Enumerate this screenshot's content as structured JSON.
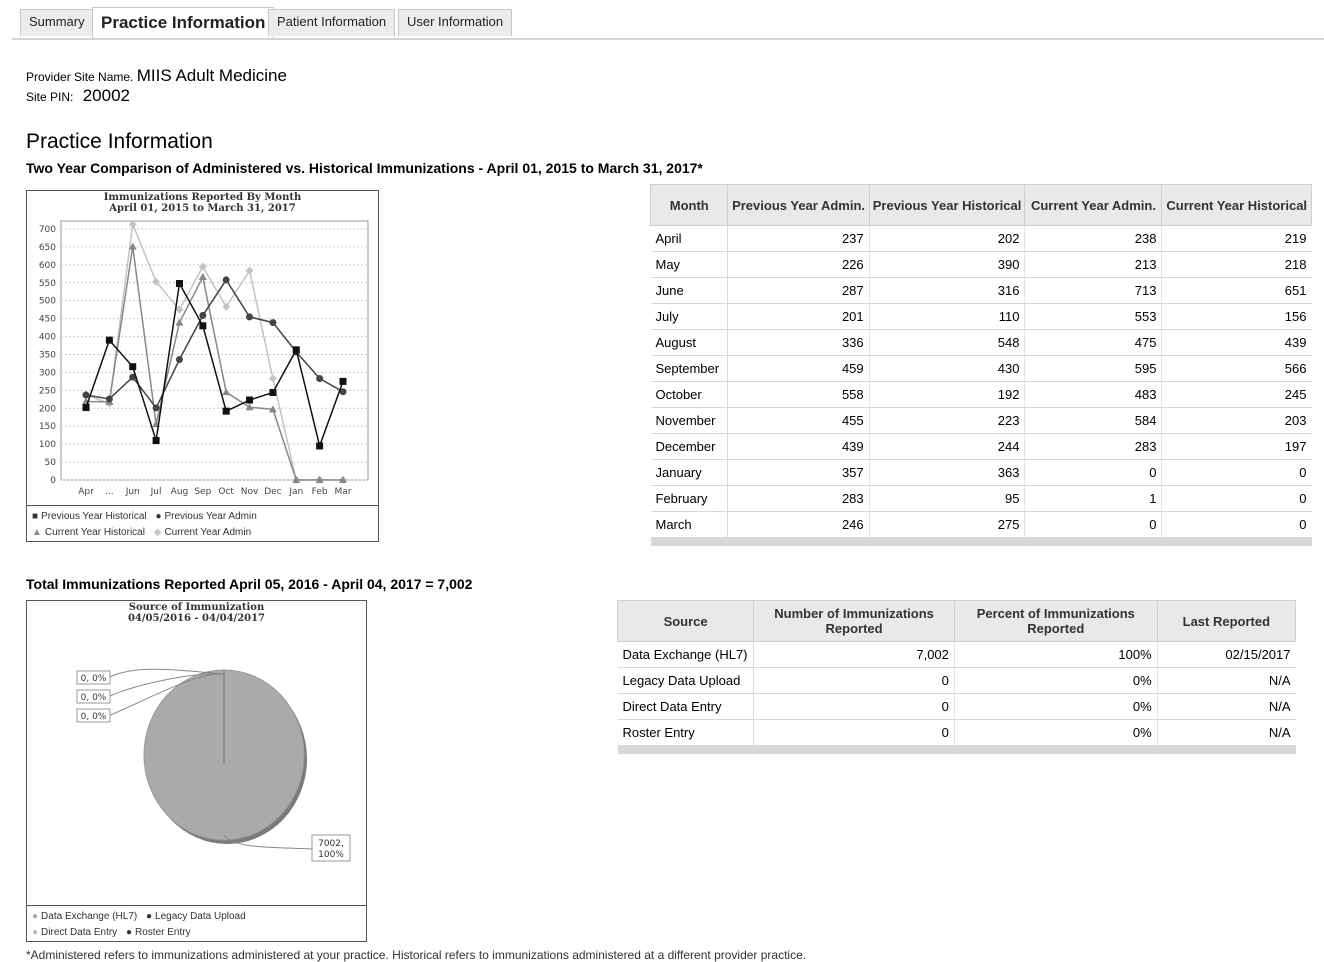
{
  "tabs": [
    "Summary",
    "Practice Information",
    "Patient Information",
    "User Information"
  ],
  "site": {
    "name_label": "Provider Site Name.",
    "name_value": "MIIS Adult Medicine",
    "pin_label": "Site PIN:",
    "pin_value": "20002"
  },
  "section_title": "Practice Information",
  "comparison_title": "Two Year Comparison of Administered vs. Historical Immunizations - April 01, 2015 to March 31, 2017*",
  "total_title": "Total Immunizations Reported April 05, 2016 - April 04, 2017 = 7,002",
  "footnote": "*Administered refers to immunizations administered at your practice. Historical refers to immunizations administered at a different provider practice.",
  "chart_data": [
    {
      "type": "line",
      "title": "Immunizations Reported By Month",
      "subtitle": "April 01, 2015 to March 31, 2017",
      "categories": [
        "Apr",
        "May",
        "Jun",
        "Jul",
        "Aug",
        "Sep",
        "Oct",
        "Nov",
        "Dec",
        "Jan",
        "Feb",
        "Mar"
      ],
      "x_tick_labels": [
        "Apr",
        "...",
        "Jun",
        "Jul",
        "Aug",
        "Sep",
        "Oct",
        "Nov",
        "Dec",
        "Jan",
        "Feb",
        "Mar"
      ],
      "ylim": [
        0,
        700
      ],
      "y_ticks": [
        0,
        50,
        100,
        150,
        200,
        250,
        300,
        350,
        400,
        450,
        500,
        550,
        600,
        650,
        700
      ],
      "grid": true,
      "legend_position": "bottom",
      "series": [
        {
          "name": "Previous Year Historical",
          "values": [
            202,
            390,
            316,
            110,
            548,
            430,
            192,
            223,
            244,
            363,
            95,
            275
          ],
          "color": "#111111",
          "marker": "square"
        },
        {
          "name": "Previous Year Admin",
          "values": [
            237,
            226,
            287,
            201,
            336,
            459,
            558,
            455,
            439,
            357,
            283,
            246
          ],
          "color": "#444444",
          "marker": "circle"
        },
        {
          "name": "Current Year Historical",
          "values": [
            219,
            218,
            651,
            156,
            439,
            566,
            245,
            203,
            197,
            0,
            0,
            0
          ],
          "color": "#888888",
          "marker": "triangle"
        },
        {
          "name": "Current Year Admin",
          "values": [
            238,
            213,
            713,
            553,
            475,
            595,
            483,
            584,
            283,
            0,
            1,
            0
          ],
          "color": "#c4c4c4",
          "marker": "diamond"
        }
      ]
    },
    {
      "type": "pie",
      "title": "Source of Immunization",
      "subtitle": "04/05/2016 - 04/04/2017",
      "slice_labels": [
        "0, 0%",
        "0, 0%",
        "0, 0%",
        "7002, 100%"
      ],
      "slices": [
        {
          "name": "Data Exchange (HL7)",
          "value": 7002,
          "percent": 100,
          "color": "#aaaaaa"
        },
        {
          "name": "Legacy Data Upload",
          "value": 0,
          "percent": 0,
          "color": "#111111"
        },
        {
          "name": "Direct Data Entry",
          "value": 0,
          "percent": 0,
          "color": "#bbbbbb"
        },
        {
          "name": "Roster Entry",
          "value": 0,
          "percent": 0,
          "color": "#222222"
        }
      ],
      "legend_position": "bottom"
    },
    {
      "type": "table",
      "columns": [
        "Month",
        "Previous Year Admin.",
        "Previous Year Historical",
        "Current Year Admin.",
        "Current Year Historical"
      ],
      "rows": [
        [
          "April",
          "237",
          "202",
          "238",
          "219"
        ],
        [
          "May",
          "226",
          "390",
          "213",
          "218"
        ],
        [
          "June",
          "287",
          "316",
          "713",
          "651"
        ],
        [
          "July",
          "201",
          "110",
          "553",
          "156"
        ],
        [
          "August",
          "336",
          "548",
          "475",
          "439"
        ],
        [
          "September",
          "459",
          "430",
          "595",
          "566"
        ],
        [
          "October",
          "558",
          "192",
          "483",
          "245"
        ],
        [
          "November",
          "455",
          "223",
          "584",
          "203"
        ],
        [
          "December",
          "439",
          "244",
          "283",
          "197"
        ],
        [
          "January",
          "357",
          "363",
          "0",
          "0"
        ],
        [
          "February",
          "283",
          "95",
          "1",
          "0"
        ],
        [
          "March",
          "246",
          "275",
          "0",
          "0"
        ]
      ]
    },
    {
      "type": "table",
      "columns": [
        "Source",
        "Number of Immunizations Reported",
        "Percent of Immunizations Reported",
        "Last Reported"
      ],
      "rows": [
        [
          "Data Exchange (HL7)",
          "7,002",
          "100%",
          "02/15/2017"
        ],
        [
          "Legacy Data Upload",
          "0",
          "0%",
          "N/A"
        ],
        [
          "Direct Data Entry",
          "0",
          "0%",
          "N/A"
        ],
        [
          "Roster Entry",
          "0",
          "0%",
          "N/A"
        ]
      ]
    }
  ]
}
